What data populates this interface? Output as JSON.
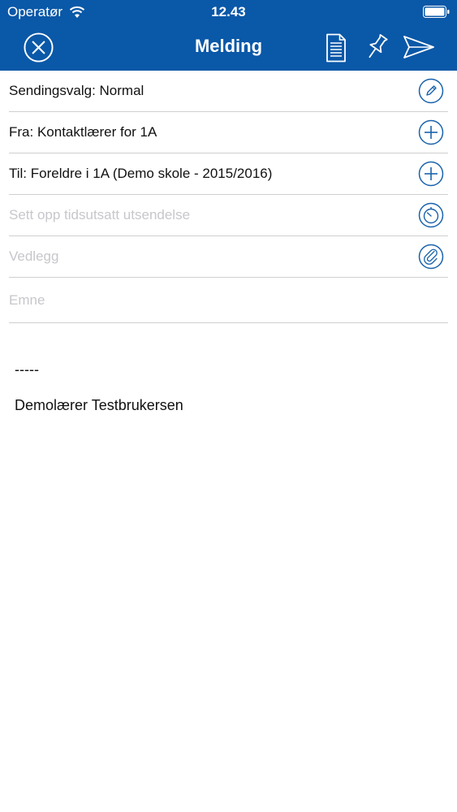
{
  "status_bar": {
    "carrier": "Operatør",
    "time": "12.43"
  },
  "nav": {
    "title": "Melding",
    "left_icon": "close-circle-icon",
    "right_icons": [
      "document-icon",
      "pin-icon",
      "send-icon"
    ]
  },
  "fields": {
    "sending_option": "Sendingsvalg: Normal",
    "from": "Fra: Kontaktlærer for 1A",
    "to": "Til: Foreldre i 1A (Demo skole - 2015/2016)",
    "schedule_placeholder": "Sett opp tidsutsatt utsendelse",
    "attachment_placeholder": "Vedlegg",
    "subject_placeholder": "Emne"
  },
  "message_body": {
    "separator": "-----",
    "signature": "Demolærer Testbrukersen"
  },
  "colors": {
    "header": "#0a58a8",
    "icon_accent": "#1a63ac",
    "divider": "#cfcfcf",
    "placeholder": "#c7c7cc"
  }
}
